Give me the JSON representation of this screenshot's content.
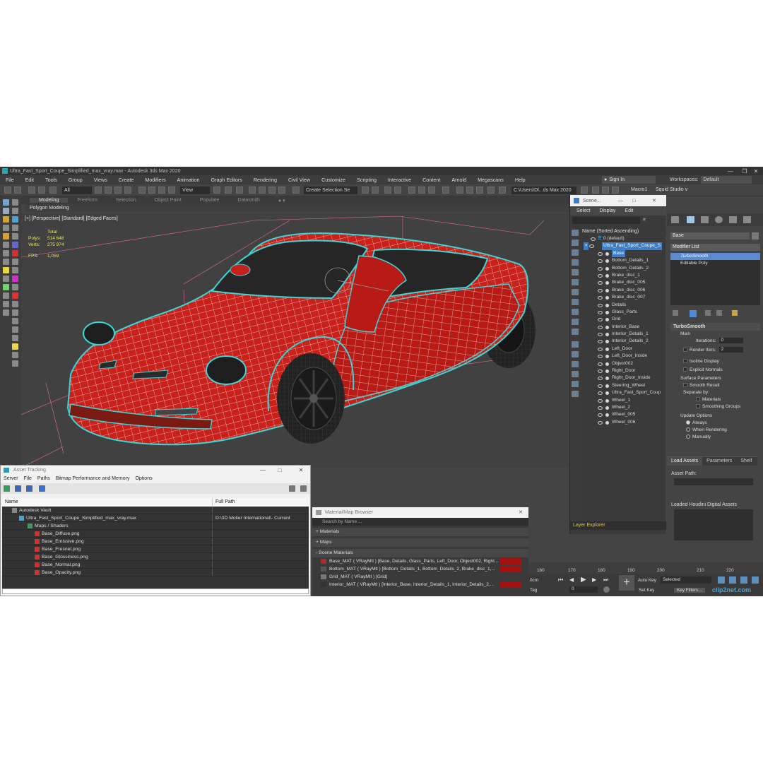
{
  "window": {
    "title": "Ultra_Fast_Sport_Coupe_Simplified_max_vray.max - Autodesk 3ds Max 2020"
  },
  "menubar": {
    "items": [
      "File",
      "Edit",
      "Tools",
      "Group",
      "Views",
      "Create",
      "Modifiers",
      "Animation",
      "Graph Editors",
      "Rendering",
      "Civil View",
      "Customize",
      "Scripting",
      "Interactive",
      "Content",
      "Arnold",
      "Megascans",
      "Help"
    ]
  },
  "account": {
    "sign_in": "Sign In",
    "workspaces_label": "Workspaces:",
    "workspace_value": "Default"
  },
  "toolbar": {
    "filter_value": "All",
    "coord_value": "View",
    "selection_set_placeholder": "Create Selection Se",
    "path_value": "C:\\Users\\Dl...ds Max 2020",
    "macro_label": "Macro1",
    "squid_label": "Squid Studio v"
  },
  "ribbon": {
    "tabs": [
      "Modeling",
      "Freeform",
      "Selection",
      "Object Paint",
      "Populate",
      "Datasmith"
    ],
    "active_tab": "Modeling",
    "sub_label": "Polygon Modeling"
  },
  "viewport": {
    "label": "[+] [Perspective] [Standard] [Edged Faces]",
    "stats_total": "Total",
    "stats_polys_label": "Polys:",
    "stats_polys": "514 648",
    "stats_verts_label": "Verts:",
    "stats_verts": "275 974",
    "fps_label": "FPS:",
    "fps_value": "1,059"
  },
  "scene_explorer": {
    "title": "Scene...",
    "menu": [
      "Select",
      "Display",
      "Edit"
    ],
    "column_header": "Name (Sorted Ascending)",
    "root_default": "0 (default)",
    "root_object": "Ultra_Fast_Sport_Coupe_S",
    "items": [
      "Base",
      "Bottom_Details_1",
      "Bottom_Details_2",
      "Brake_disc_1",
      "Brake_disc_005",
      "Brake_disc_006",
      "Brake_disc_007",
      "Details",
      "Glass_Parts",
      "Grid",
      "Interior_Base",
      "Interior_Details_1",
      "Interior_Details_2",
      "Left_Door",
      "Left_Door_Inside",
      "Object002",
      "Right_Door",
      "Right_Door_Inside",
      "Steering_Wheel",
      "Ultra_Fast_Sport_Coup",
      "Wheel_1",
      "Wheel_2",
      "Wheel_005",
      "Wheel_006"
    ],
    "footer": "Layer Explorer"
  },
  "command_panel": {
    "object_name": "Base",
    "modifier_list": "Modifier List",
    "stack": [
      "TurboSmooth",
      "Editable Poly"
    ],
    "rollout_title": "TurboSmooth",
    "main_label": "Main",
    "iterations_label": "Iterations:",
    "iterations_value": "0",
    "render_iters_label": "Render Iters:",
    "render_iters_value": "2",
    "isoline_label": "Isoline Display",
    "explicit_label": "Explicit Normals",
    "surface_label": "Surface Parameters",
    "smooth_result_label": "Smooth Result",
    "separate_label": "Separate by:",
    "materials_label": "Materials",
    "smoothing_groups_label": "Smoothing Groups",
    "update_label": "Update Options",
    "always_label": "Always",
    "when_rendering_label": "When Rendering",
    "manually_label": "Manually"
  },
  "load_assets": {
    "tabs": [
      "Load Assets",
      "Parameters",
      "Shelf"
    ],
    "asset_path_label": "Asset Path:",
    "loaded_label": "Loaded Houdini Digital Assets"
  },
  "timeline": {
    "ticks": [
      "160",
      "170",
      "180",
      "190",
      "200",
      "210",
      "220"
    ],
    "frame_field": "0cm",
    "tag_label": "Tag",
    "auto_key": "Auto Key",
    "selected_value": "Selected",
    "set_key": "Set Key",
    "key_filters": "Key Filters...",
    "frame_value": "0"
  },
  "asset_tracking": {
    "title": "Asset Tracking",
    "menu": [
      "Server",
      "File",
      "Paths",
      "Bitmap Performance and Memory",
      "Options"
    ],
    "col_name": "Name",
    "col_path": "Full Path",
    "rows": [
      {
        "name": "Autodesk Vault",
        "path": ""
      },
      {
        "name": "Ultra_Fast_Sport_Coupe_Simplified_max_vray.max",
        "path": "D:\\3D Molier International\\- Current"
      },
      {
        "name": "Maps / Shaders",
        "path": ""
      },
      {
        "name": "Base_Diffuse.png",
        "path": ""
      },
      {
        "name": "Base_Emissive.png",
        "path": ""
      },
      {
        "name": "Base_Fresnel.png",
        "path": ""
      },
      {
        "name": "Base_Glossiness.png",
        "path": ""
      },
      {
        "name": "Base_Normal.png",
        "path": ""
      },
      {
        "name": "Base_Opacity.png",
        "path": ""
      }
    ]
  },
  "material_browser": {
    "title": "Material/Map Browser",
    "search_placeholder": "Search by Name ...",
    "sections": [
      "+ Materials",
      "+ Maps",
      "- Scene Materials"
    ],
    "materials": [
      "Base_MAT ( VRayMtl ) [Base, Details, Glass_Parts, Left_Door, Object002, Right...",
      "Bottom_MAT ( VRayMtl ) [Bottom_Details_1, Bottom_Details_2, Brake_disc_1,...",
      "Grid_MAT ( VRayMtl ) [Grid]",
      "Interior_MAT ( VRayMtl ) [Interior_Base, Interior_Details_1, Interior_Details_2,..."
    ]
  },
  "watermark": "clip2net.com",
  "colors": {
    "mesh": "#c8201a",
    "wire": "#ffffff",
    "outline": "#39d6d6",
    "bg": "#444444",
    "accent": "#3d7ec7"
  }
}
